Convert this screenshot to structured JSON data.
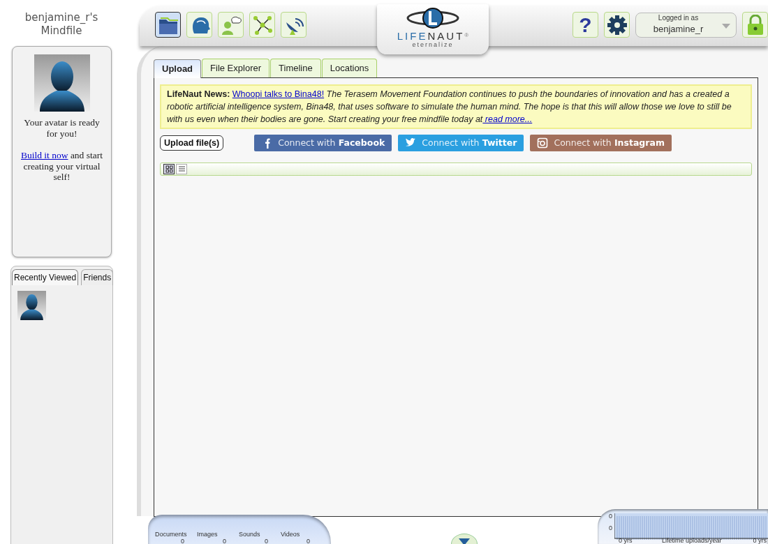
{
  "sidebar": {
    "title": "benjamine_r's Mindfile"
  },
  "avatar_card": {
    "message": "Your avatar is ready for you!",
    "link": "Build it now",
    "link_tail": " and start creating your virtual self!"
  },
  "side_tabs": [
    {
      "label": "Recently Viewed",
      "selected": true
    },
    {
      "label": "Friends",
      "selected": false
    }
  ],
  "toolbar": [
    {
      "kind": "folder",
      "selected": true
    },
    {
      "kind": "head",
      "selected": false
    },
    {
      "kind": "chat",
      "selected": false
    },
    {
      "kind": "network",
      "selected": false
    },
    {
      "kind": "satellite",
      "selected": false
    }
  ],
  "logo": {
    "first": "LIFE",
    "second": "NAUT",
    "mark": "®",
    "tagline": "eternalize"
  },
  "help_button": "?",
  "user_menu": {
    "caption": "Logged in as",
    "username": "benjamine_r"
  },
  "tabs": [
    {
      "label": "Upload",
      "selected": true
    },
    {
      "label": "File Explorer",
      "selected": false
    },
    {
      "label": "Timeline",
      "selected": false
    },
    {
      "label": "Locations",
      "selected": false
    }
  ],
  "news": {
    "heading": "LifeNaut News:",
    "link": "Whoopi talks to Bina48!",
    "body": " The Terasem Movement Foundation continues to push the boundaries of innovation and has a created a robotic artificial intelligence system, Bina48, that uses software to simulate the human mind.  The hope is that this will allow those we love to still be with us even when their bodies are gone. Start creating your free mindfile today at",
    "more": " read more..."
  },
  "upload_button": "Upload file(s)",
  "social": [
    {
      "kind": "facebook",
      "prefix": "Connect with",
      "name": "Facebook",
      "color": "#4a6ba6"
    },
    {
      "kind": "twitter",
      "prefix": "Connect with",
      "name": "Twitter",
      "color": "#2a9fe0"
    },
    {
      "kind": "instagram",
      "prefix": "Connect with",
      "name": "Instagram",
      "color": "#a2705c"
    }
  ],
  "view_modes": [
    {
      "kind": "grid",
      "selected": true
    },
    {
      "kind": "list",
      "selected": false
    }
  ],
  "counts": [
    {
      "label": "Documents",
      "value": "0"
    },
    {
      "label": "Images",
      "value": "0"
    },
    {
      "label": "Sounds",
      "value": "0"
    },
    {
      "label": "Videos",
      "value": "0"
    }
  ],
  "upload_chart": {
    "y_labels": [
      "0",
      "0"
    ],
    "x_start": "0 yrs",
    "x_end": "0 yrs",
    "caption": "Lifetime uploads/year"
  }
}
